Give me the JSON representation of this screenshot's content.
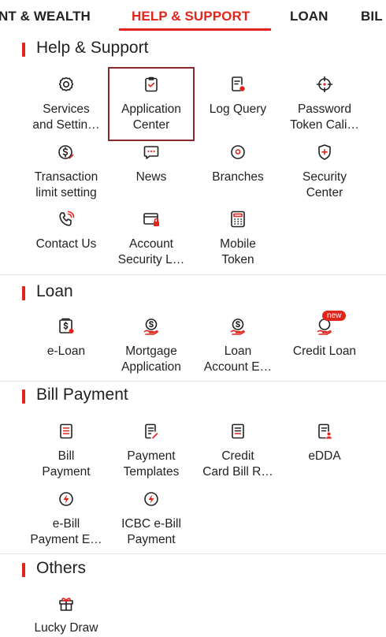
{
  "tabs": [
    "NT & WEALTH",
    "HELP & SUPPORT",
    "LOAN",
    "BIL"
  ],
  "sections": {
    "help": {
      "title": "Help & Support",
      "items": [
        {
          "label": "Services\nand Settin…",
          "icon": "gear-icon"
        },
        {
          "label": "Application\nCenter",
          "icon": "clipboard-check-icon"
        },
        {
          "label": "Log Query",
          "icon": "document-search-icon"
        },
        {
          "label": "Password\nToken Cali…",
          "icon": "crosshair-icon"
        },
        {
          "label": "Transaction\nlimit setting",
          "icon": "money-limit-icon"
        },
        {
          "label": "News",
          "icon": "chat-bubble-icon"
        },
        {
          "label": "Branches",
          "icon": "location-pin-icon"
        },
        {
          "label": "Security\nCenter",
          "icon": "shield-plus-icon"
        },
        {
          "label": "Contact Us",
          "icon": "phone-icon"
        },
        {
          "label": "Account\nSecurity L…",
          "icon": "card-lock-icon"
        },
        {
          "label": "Mobile\nToken",
          "icon": "keypad-token-icon"
        }
      ]
    },
    "loan": {
      "title": "Loan",
      "items": [
        {
          "label": "e-Loan",
          "icon": "e-loan-icon"
        },
        {
          "label": "Mortgage\nApplication",
          "icon": "mortgage-icon"
        },
        {
          "label": "Loan\nAccount E…",
          "icon": "loan-account-icon"
        },
        {
          "label": "Credit Loan",
          "icon": "credit-loan-icon",
          "badge": "new"
        }
      ]
    },
    "bill": {
      "title": "Bill Payment",
      "items": [
        {
          "label": "Bill\nPayment",
          "icon": "bill-icon"
        },
        {
          "label": "Payment\nTemplates",
          "icon": "template-edit-icon"
        },
        {
          "label": "Credit\nCard Bill R…",
          "icon": "card-bill-icon"
        },
        {
          "label": "eDDA",
          "icon": "edda-icon"
        },
        {
          "label": "e-Bill\nPayment E…",
          "icon": "e-bill-icon"
        },
        {
          "label": "ICBC e-Bill\nPayment",
          "icon": "icbc-e-bill-icon"
        }
      ]
    },
    "others": {
      "title": "Others",
      "items": [
        {
          "label": "Lucky Draw",
          "icon": "gift-icon"
        }
      ]
    }
  },
  "colors": {
    "accent": "#e1251b",
    "highlight_border": "#8a2a2a",
    "text": "#222222"
  }
}
